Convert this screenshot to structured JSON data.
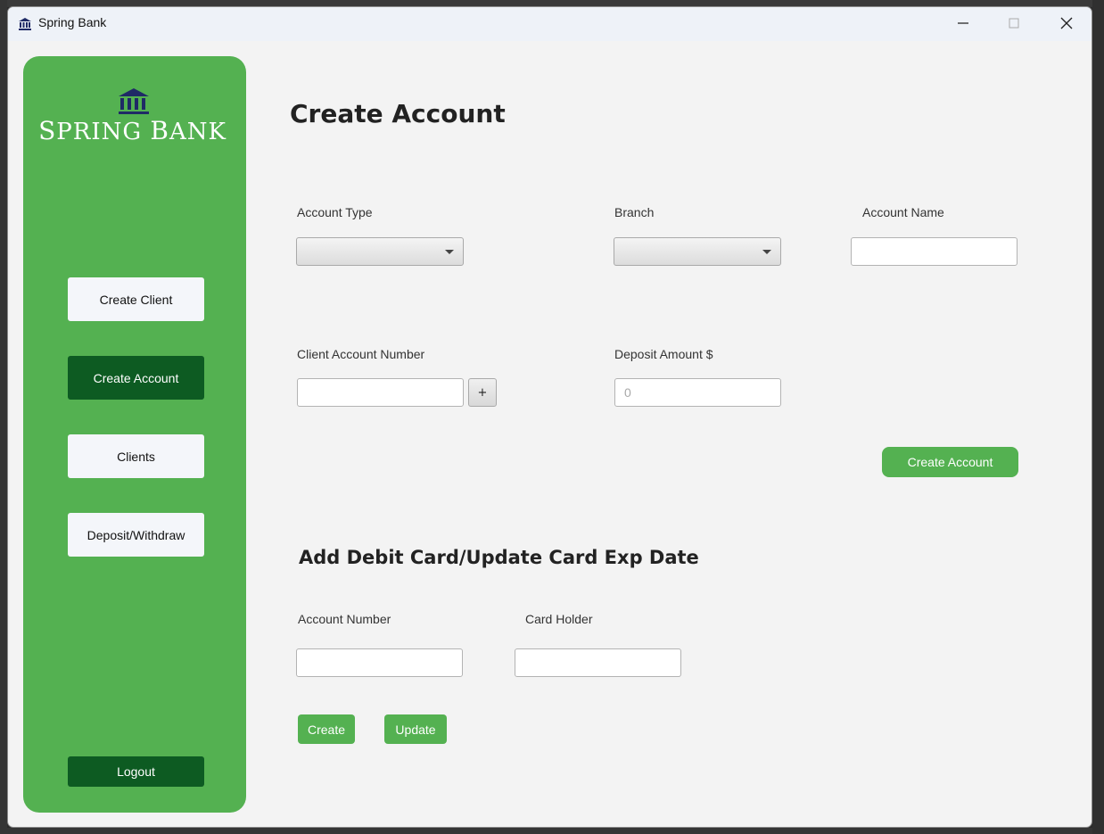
{
  "window": {
    "title": "Spring Bank"
  },
  "sidebar": {
    "logo_text_first": "S",
    "logo_text_rest1": "PRING ",
    "logo_text_second": "B",
    "logo_text_rest2": "ANK",
    "items": [
      {
        "label": "Create Client"
      },
      {
        "label": "Create Account"
      },
      {
        "label": "Clients"
      },
      {
        "label": "Deposit/Withdraw"
      }
    ],
    "logout_label": "Logout"
  },
  "create_account": {
    "title": "Create Account",
    "account_type_label": "Account Type",
    "branch_label": "Branch",
    "account_name_label": "Account Name",
    "client_account_number_label": "Client Account Number",
    "plus_label": "+",
    "deposit_amount_label": "Deposit Amount $",
    "deposit_placeholder": "0",
    "submit_label": "Create Account"
  },
  "debit_card": {
    "title": "Add Debit Card/Update Card Exp Date",
    "account_number_label": "Account Number",
    "card_holder_label": "Card Holder",
    "create_label": "Create",
    "update_label": "Update"
  },
  "colors": {
    "accent_green": "#54b151",
    "dark_green": "#0d5b22",
    "logo_navy": "#1f2a66"
  }
}
